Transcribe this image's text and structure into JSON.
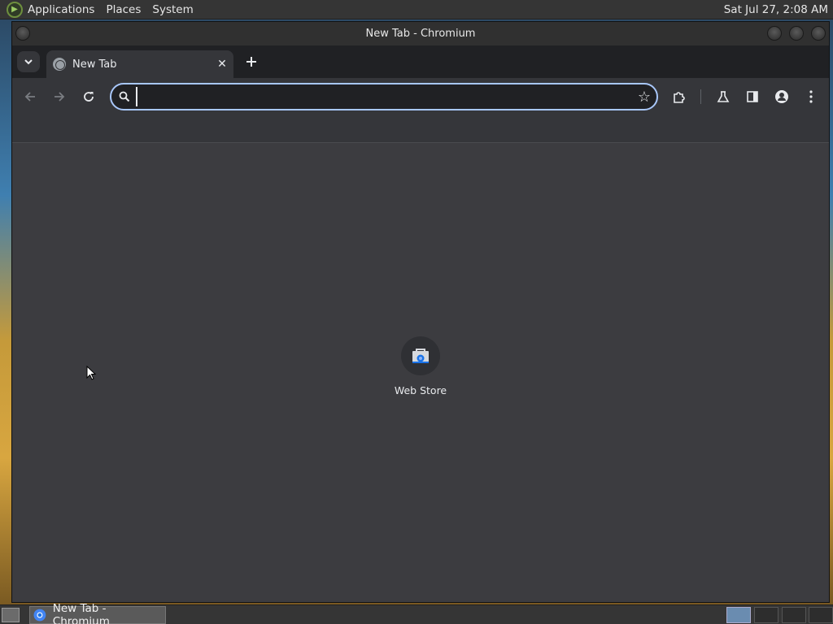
{
  "top_panel": {
    "menus": [
      "Applications",
      "Places",
      "System"
    ],
    "clock": "Sat Jul 27,  2:08 AM"
  },
  "window": {
    "title": "New Tab - Chromium"
  },
  "tabs": [
    {
      "title": "New Tab",
      "icon": "globe-icon"
    }
  ],
  "toolbar": {
    "back_icon": "back-arrow-icon",
    "forward_icon": "forward-arrow-icon",
    "reload_icon": "reload-icon",
    "omnibox_value": "",
    "omnibox_placeholder": ""
  },
  "ntp": {
    "shortcuts": [
      {
        "label": "Web Store",
        "icon": "web-store-icon"
      }
    ]
  },
  "taskbar": {
    "items": [
      {
        "label": "New Tab - Chromium",
        "icon": "chromium-icon"
      }
    ]
  },
  "colors": {
    "omnibox_focus": "#a8c7fa",
    "tabstrip": "#202124",
    "toolbar": "#35363a",
    "content": "#3c3c40"
  }
}
